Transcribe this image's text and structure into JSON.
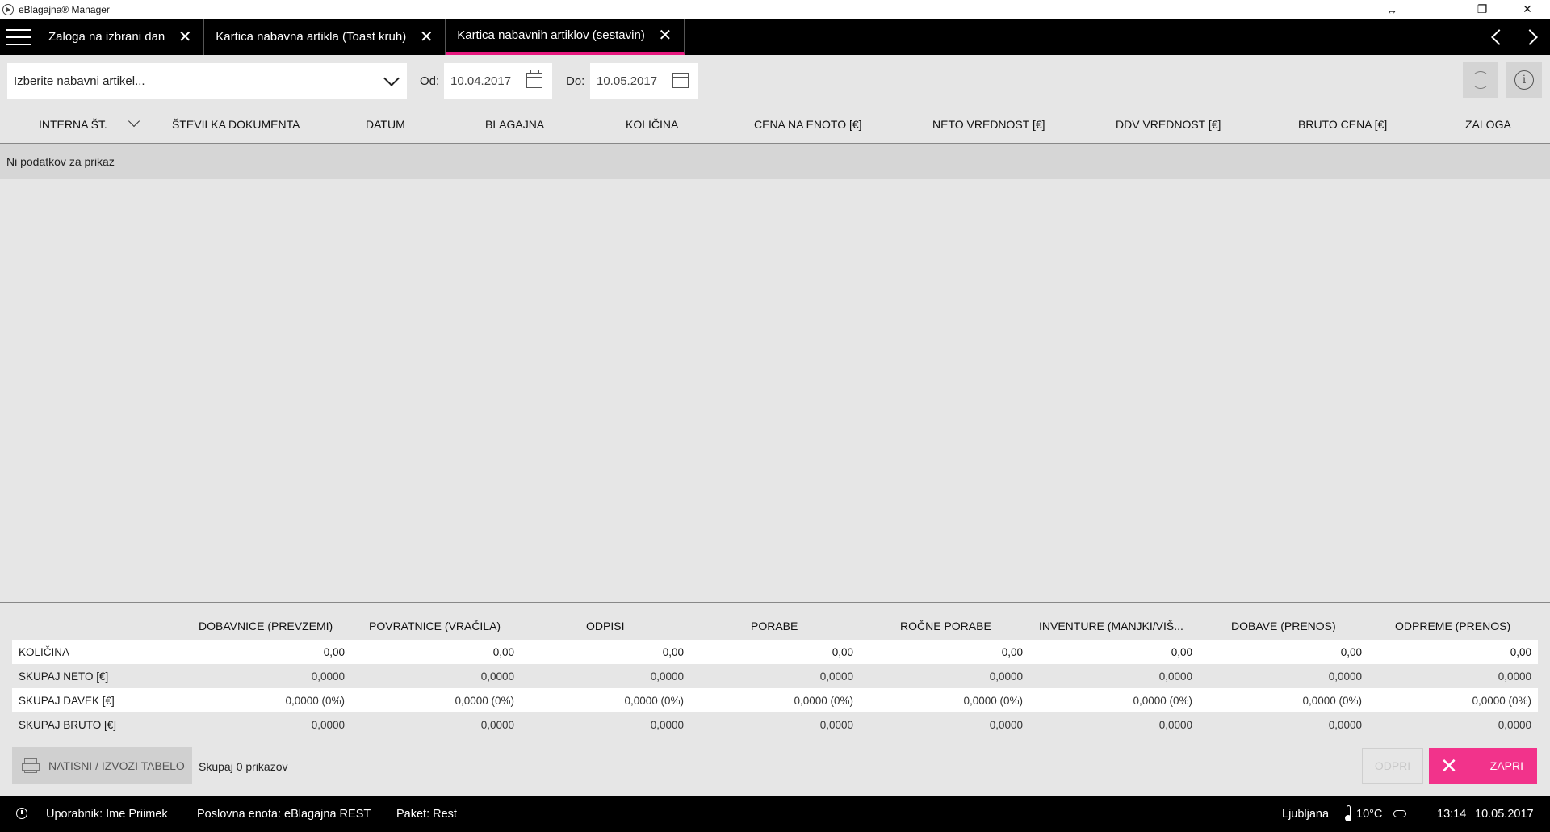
{
  "window": {
    "title": "eBlagajna® Manager",
    "controls": {
      "resize": "↔",
      "minimize": "—",
      "restore": "❐",
      "close": "✕"
    }
  },
  "tabs": [
    {
      "label": "Zaloga na izbrani dan",
      "active": false
    },
    {
      "label": "Kartica nabavna artikla (Toast kruh)",
      "active": false
    },
    {
      "label": "Kartica nabavnih artiklov (sestavin)",
      "active": true
    }
  ],
  "filters": {
    "article_placeholder": "Izberite nabavni artikel...",
    "from_label": "Od:",
    "from_date": "10.04.2017",
    "to_label": "Do:",
    "to_date": "10.05.2017"
  },
  "table": {
    "columns": [
      "INTERNA ŠT.",
      "ŠTEVILKA DOKUMENTA",
      "DATUM",
      "BLAGAJNA",
      "KOLIČINA",
      "CENA NA ENOTO [€]",
      "NETO VREDNOST [€]",
      "DDV VREDNOST [€]",
      "BRUTO CENA [€]",
      "ZALOGA"
    ],
    "empty_text": "Ni podatkov za prikaz"
  },
  "summary": {
    "columns": [
      "DOBAVNICE (PREVZEMI)",
      "POVRATNICE (VRAČILA)",
      "ODPISI",
      "PORABE",
      "ROČNE PORABE",
      "INVENTURE (MANJKI/VIŠ...",
      "DOBAVE (PRENOS)",
      "ODPREME (PRENOS)"
    ],
    "rows": [
      {
        "label": "KOLIČINA",
        "values": [
          "0,00",
          "0,00",
          "0,00",
          "0,00",
          "0,00",
          "0,00",
          "0,00",
          "0,00"
        ]
      },
      {
        "label": "SKUPAJ NETO [€]",
        "values": [
          "0,0000",
          "0,0000",
          "0,0000",
          "0,0000",
          "0,0000",
          "0,0000",
          "0,0000",
          "0,0000"
        ]
      },
      {
        "label": "SKUPAJ DAVEK [€]",
        "values": [
          "0,0000 (0%)",
          "0,0000 (0%)",
          "0,0000 (0%)",
          "0,0000 (0%)",
          "0,0000 (0%)",
          "0,0000 (0%)",
          "0,0000 (0%)",
          "0,0000 (0%)"
        ]
      },
      {
        "label": "SKUPAJ BRUTO [€]",
        "values": [
          "0,0000",
          "0,0000",
          "0,0000",
          "0,0000",
          "0,0000",
          "0,0000",
          "0,0000",
          "0,0000"
        ]
      }
    ]
  },
  "footer": {
    "print_label": "NATISNI / IZVOZI TABELO",
    "count_text": "Skupaj 0 prikazov",
    "open_label": "ODPRI",
    "close_label": "ZAPRI"
  },
  "status": {
    "user": "Uporabnik: Ime Priimek",
    "unit": "Poslovna enota: eBlagajna REST",
    "package": "Paket: Rest",
    "city": "Ljubljana",
    "temperature": "10°C",
    "time": "13:14",
    "date": "10.05.2017"
  },
  "colors": {
    "accent": "#e6197f",
    "close_button": "#f2338b",
    "bar": "#000000",
    "background": "#e6e6e6"
  }
}
